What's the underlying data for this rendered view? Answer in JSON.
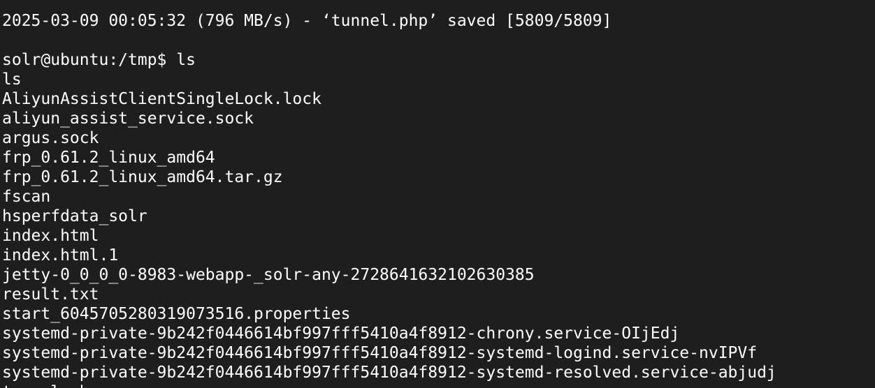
{
  "terminal": {
    "wget_status_line": "2025-03-09 00:05:32 (796 MB/s) - ‘tunnel.php’ saved [5809/5809]",
    "prompt": "solr@ubuntu:/tmp$ ",
    "command": "ls",
    "echoed_command": "ls",
    "listing": [
      "AliyunAssistClientSingleLock.lock",
      "aliyun_assist_service.sock",
      "argus.sock",
      "frp_0.61.2_linux_amd64",
      "frp_0.61.2_linux_amd64.tar.gz",
      "fscan",
      "hsperfdata_solr",
      "index.html",
      "index.html.1",
      "jetty-0_0_0_0-8983-webapp-_solr-any-2728641632102630385",
      "result.txt",
      "start_604570528031907351​6.properties",
      "systemd-private-9b242f0446614bf997fff5410a4f8912-chrony.service-OIjEdj",
      "systemd-private-9b242f0446614bf997fff5410a4f8912-systemd-logind.service-nvIPVf",
      "systemd-private-9b242f0446614bf997fff5410a4f8912-systemd-resolved.service-abjudj"
    ],
    "partial_last_line": "tunnel.php"
  }
}
